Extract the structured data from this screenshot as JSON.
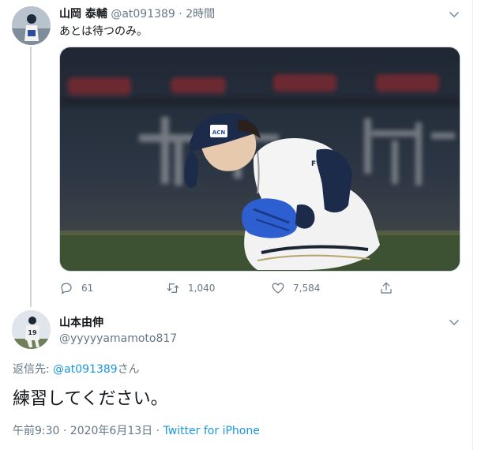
{
  "tweet": {
    "name": "山岡 泰輔",
    "handle": "@at091389",
    "separator": "·",
    "time": "2時間",
    "text": "あとは待つのみ。",
    "photo_alt": "Pitcher crouching on the field",
    "stats": {
      "replies": "61",
      "retweets": "1,040",
      "likes": "7,584"
    }
  },
  "reply": {
    "name": "山本由伸",
    "handle": "@yyyyyamamoto817",
    "reply_prefix": "返信先: ",
    "reply_to": "@at091389",
    "reply_suffix": "さん",
    "text": "練習してください。",
    "timestamp": "午前9:30 · 2020年6月13日 · ",
    "source": "Twitter for iPhone"
  },
  "photo_text": {
    "cap_logo": "ACN",
    "jersey": "FWD",
    "reply_avatar_number": "19"
  },
  "colors": {
    "link": "#1b95e0",
    "secondary_text": "#657786",
    "primary_text": "#14171a",
    "border": "#e6ecf0"
  },
  "icons": {
    "reply": "speech-bubble-icon",
    "retweet": "retweet-icon",
    "like": "heart-icon",
    "share": "share-icon",
    "more": "chevron-down-icon"
  }
}
